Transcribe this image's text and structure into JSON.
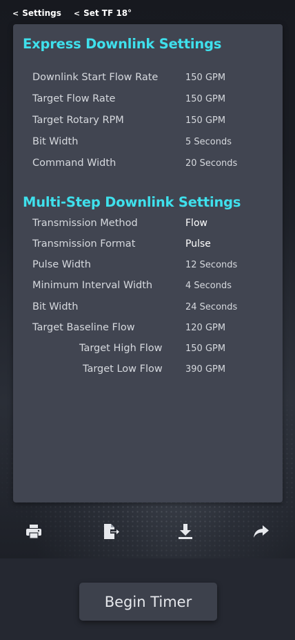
{
  "breadcrumb": {
    "items": [
      {
        "label": "Settings"
      },
      {
        "label": "Set TF 18°"
      }
    ]
  },
  "express": {
    "title": "Express Downlink Settings",
    "rows": [
      {
        "label": "Downlink Start Flow Rate",
        "value": "150 GPM"
      },
      {
        "label": "Target Flow Rate",
        "value": "150 GPM"
      },
      {
        "label": "Target Rotary RPM",
        "value": "150 GPM"
      },
      {
        "label": "Bit Width",
        "value": "5 Seconds"
      },
      {
        "label": "Command Width",
        "value": "20 Seconds"
      }
    ]
  },
  "multistep": {
    "title": "Multi-Step Downlink Settings",
    "rows": [
      {
        "label": "Transmission Method",
        "value": "Flow"
      },
      {
        "label": "Transmission Format",
        "value": "Pulse"
      },
      {
        "label": "Pulse Width",
        "value": "12 Seconds"
      },
      {
        "label": "Minimum Interval Width",
        "value": "4 Seconds"
      },
      {
        "label": "Bit Width",
        "value": "24 Seconds"
      },
      {
        "label": "Target Baseline Flow",
        "value": "120 GPM"
      },
      {
        "label": "Target High Flow",
        "value": "150 GPM"
      },
      {
        "label": "Target Low Flow",
        "value": "390 GPM"
      }
    ]
  },
  "toolbar": {
    "icons": [
      "print-icon",
      "export-file-icon",
      "download-icon",
      "share-icon"
    ]
  },
  "actions": {
    "begin_timer_label": "Begin Timer"
  },
  "colors": {
    "accent": "#3fe0ec",
    "panel": "#414551",
    "background": "#1f222b"
  }
}
